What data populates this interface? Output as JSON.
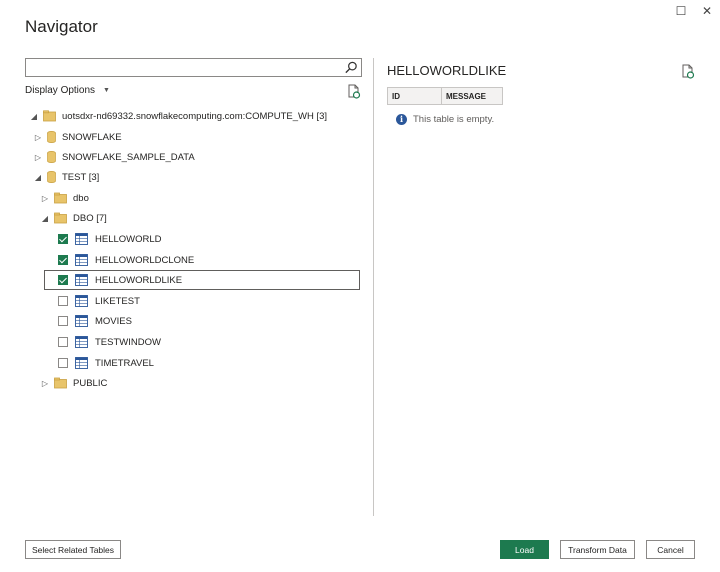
{
  "window": {
    "title": "Navigator"
  },
  "search": {
    "value": "",
    "placeholder": ""
  },
  "display_options": {
    "label": "Display Options"
  },
  "tree": {
    "server": {
      "label": "uotsdxr-nd69332.snowflakecomputing.com:COMPUTE_WH [3]"
    },
    "databases": [
      {
        "label": "SNOWFLAKE"
      },
      {
        "label": "SNOWFLAKE_SAMPLE_DATA"
      },
      {
        "label": "TEST [3]"
      }
    ],
    "schemas": [
      {
        "label": "dbo"
      },
      {
        "label": "DBO [7]"
      },
      {
        "label": "PUBLIC"
      }
    ],
    "tables": [
      {
        "label": "HELLOWORLD",
        "checked": true
      },
      {
        "label": "HELLOWORLDCLONE",
        "checked": true
      },
      {
        "label": "HELLOWORLDLIKE",
        "checked": true,
        "selected": true
      },
      {
        "label": "LIKETEST",
        "checked": false
      },
      {
        "label": "MOVIES",
        "checked": false
      },
      {
        "label": "TESTWINDOW",
        "checked": false
      },
      {
        "label": "TIMETRAVEL",
        "checked": false
      }
    ]
  },
  "preview": {
    "title": "HELLOWORLDLIKE",
    "columns": [
      "ID",
      "MESSAGE"
    ],
    "empty_message": "This table is empty."
  },
  "buttons": {
    "select_related": "Select Related Tables",
    "load": "Load",
    "transform": "Transform Data",
    "cancel": "Cancel"
  },
  "colors": {
    "accent": "#1d7a4f",
    "folder": "#e8c46a",
    "db": "#d9b44a"
  }
}
